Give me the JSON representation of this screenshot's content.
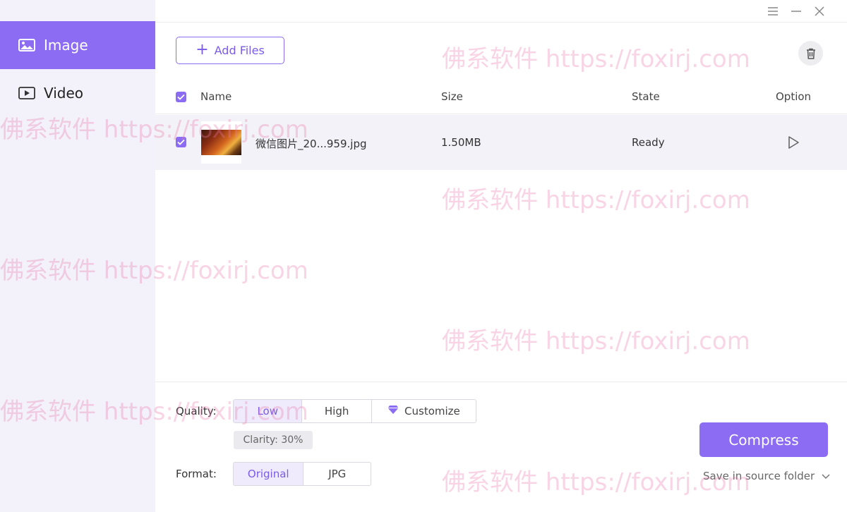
{
  "sidebar": {
    "items": [
      {
        "label": "Image",
        "icon": "image-icon",
        "active": true
      },
      {
        "label": "Video",
        "icon": "video-icon",
        "active": false
      }
    ]
  },
  "window_controls": [
    "menu-icon",
    "minimize-icon",
    "close-icon"
  ],
  "toolbar": {
    "add_files_label": "Add Files",
    "trash_icon": "trash-icon"
  },
  "table": {
    "headers": {
      "name": "Name",
      "size": "Size",
      "state": "State",
      "option": "Option"
    },
    "all_checked": true,
    "rows": [
      {
        "checked": true,
        "name": "微信图片_20...959.jpg",
        "size": "1.50MB",
        "state": "Ready",
        "option_icon": "play-icon"
      }
    ]
  },
  "settings": {
    "quality_label": "Quality:",
    "quality_options": [
      "Low",
      "High",
      "Customize"
    ],
    "quality_selected": "Low",
    "clarity": "Clarity: 30%",
    "format_label": "Format:",
    "format_options": [
      "Original",
      "JPG"
    ],
    "format_selected": "Original"
  },
  "actions": {
    "compress_label": "Compress",
    "save_location": "Save in source folder"
  },
  "watermark": "佛系软件 https://foxirj.com",
  "colors": {
    "accent": "#8c6cf3",
    "sidebar_bg": "#f3f1f9",
    "row_bg": "#f3f2f8"
  }
}
